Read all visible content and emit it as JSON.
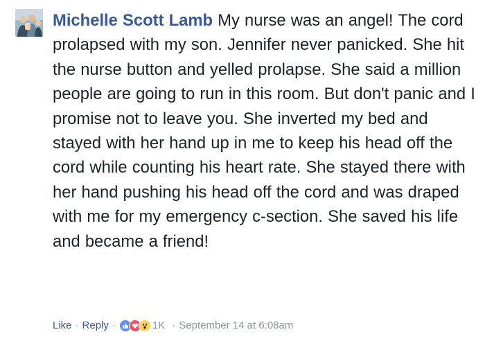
{
  "comment": {
    "author": "Michelle Scott Lamb",
    "text": "My nurse was an angel! The cord prolapsed with my son. Jennifer never panicked. She hit the nurse button and yelled prolapse. She said a million people are going to run in this room. But don't panic and I promise not to leave you. She inverted my bed and stayed with her hand up in me to keep his head off the cord while counting his heart rate. She stayed there with her hand pushing his head off the cord and was draped with me for my emergency c-section. She saved his life and became a friend!",
    "avatar_icon": "profile-photo"
  },
  "actions": {
    "like_label": "Like",
    "reply_label": "Reply",
    "separator": "·",
    "reactions": [
      {
        "icon": "like-reaction-icon",
        "color": "#5890ff"
      },
      {
        "icon": "love-reaction-icon",
        "color": "#f25268"
      },
      {
        "icon": "wow-reaction-icon",
        "color": "#fcd25b"
      }
    ],
    "reaction_count": "1K",
    "timestamp": "September 14 at 6:08am"
  },
  "colors": {
    "link": "#365899",
    "text": "#1d2129",
    "meta": "#90949c"
  }
}
